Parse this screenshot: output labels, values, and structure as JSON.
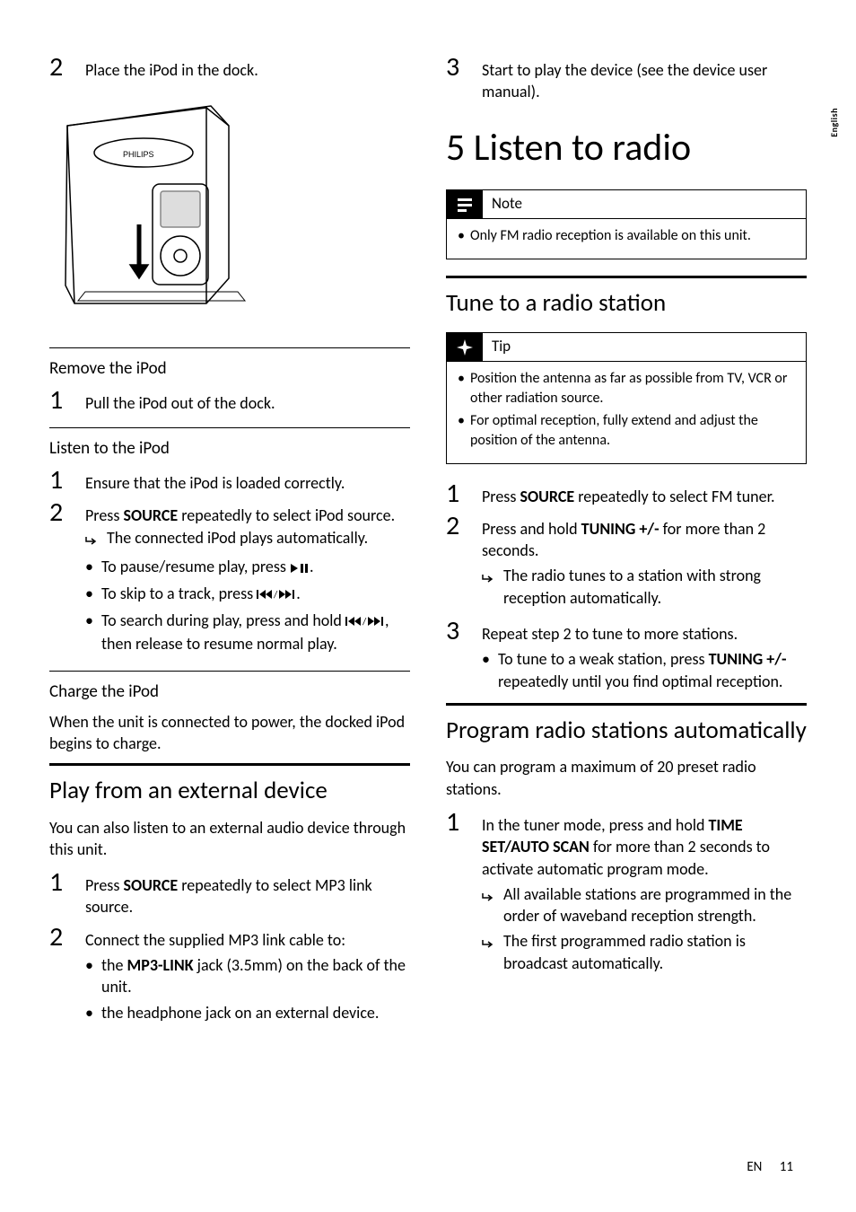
{
  "side_tab": "English",
  "footer": {
    "lang": "EN",
    "page": "11"
  },
  "left": {
    "step2": {
      "n": "2",
      "t": "Place the iPod in the dock."
    },
    "h_remove": "Remove the iPod",
    "remove_step1": {
      "n": "1",
      "t": "Pull the iPod out of the dock."
    },
    "h_listen": "Listen to the iPod",
    "listen_step1": {
      "n": "1",
      "t": "Ensure that the iPod is loaded correctly."
    },
    "listen_step2": {
      "n": "2",
      "t_a": "Press ",
      "t_bold": "SOURCE",
      "t_b": " repeatedly to select iPod source."
    },
    "listen_result": "The connected iPod plays automatically.",
    "listen_bul1_a": "To pause/resume play, press ",
    "listen_bul1_b": ".",
    "listen_bul2_a": "To skip to a track, press ",
    "listen_bul2_b": ".",
    "listen_bul3_a": "To search during play, press and hold ",
    "listen_bul3_b": ", then release to resume normal play.",
    "h_charge": "Charge the iPod",
    "charge_body": "When the unit is connected to power, the docked iPod begins to charge.",
    "h_play_ext": "Play from an external device",
    "ext_body": "You can also listen to an external audio device through this unit.",
    "ext_step1": {
      "n": "1",
      "t_a": "Press ",
      "t_bold": "SOURCE",
      "t_b": " repeatedly to select MP3 link source."
    },
    "ext_step2": {
      "n": "2",
      "t": "Connect the supplied MP3 link cable to:"
    },
    "ext_bul1_a": "the ",
    "ext_bul1_bold": "MP3-LINK",
    "ext_bul1_b": " jack (3.5mm) on the back of the unit.",
    "ext_bul2": "the headphone jack on an external device."
  },
  "right": {
    "step3": {
      "n": "3",
      "t": "Start to play the device (see the device user manual)."
    },
    "h_chapter": "5  Listen to radio",
    "note_label": "Note",
    "note_item": "Only FM radio reception is available on this unit.",
    "h_tune": "Tune to a radio station",
    "tip_label": "Tip",
    "tip_item1": "Position the antenna as far as possible from TV, VCR or other radiation source.",
    "tip_item2": "For optimal reception, fully extend and adjust the position of the antenna.",
    "tune_step1": {
      "n": "1",
      "t_a": "Press ",
      "t_bold": "SOURCE",
      "t_b": " repeatedly to select FM tuner."
    },
    "tune_step2": {
      "n": "2",
      "t_a": "Press and hold ",
      "t_bold": "TUNING +/-",
      "t_b": " for more than 2 seconds."
    },
    "tune_result": "The radio tunes to a station with strong reception automatically.",
    "tune_step3": {
      "n": "3",
      "t": "Repeat step 2 to tune to more stations."
    },
    "tune_bul_a": "To tune to a weak station, press ",
    "tune_bul_bold": "TUNING +/-",
    "tune_bul_b": " repeatedly until you find optimal reception.",
    "h_program": "Program radio stations automatically",
    "program_body": "You can program a maximum of 20 preset radio stations.",
    "program_step1": {
      "n": "1",
      "t_a": "In the tuner mode, press and hold ",
      "t_bold": "TIME SET/AUTO SCAN",
      "t_b": " for more than 2 seconds to activate automatic program mode."
    },
    "program_result1": "All available stations are programmed in the order of waveband reception strength.",
    "program_result2": "The first programmed radio station is broadcast automatically."
  }
}
